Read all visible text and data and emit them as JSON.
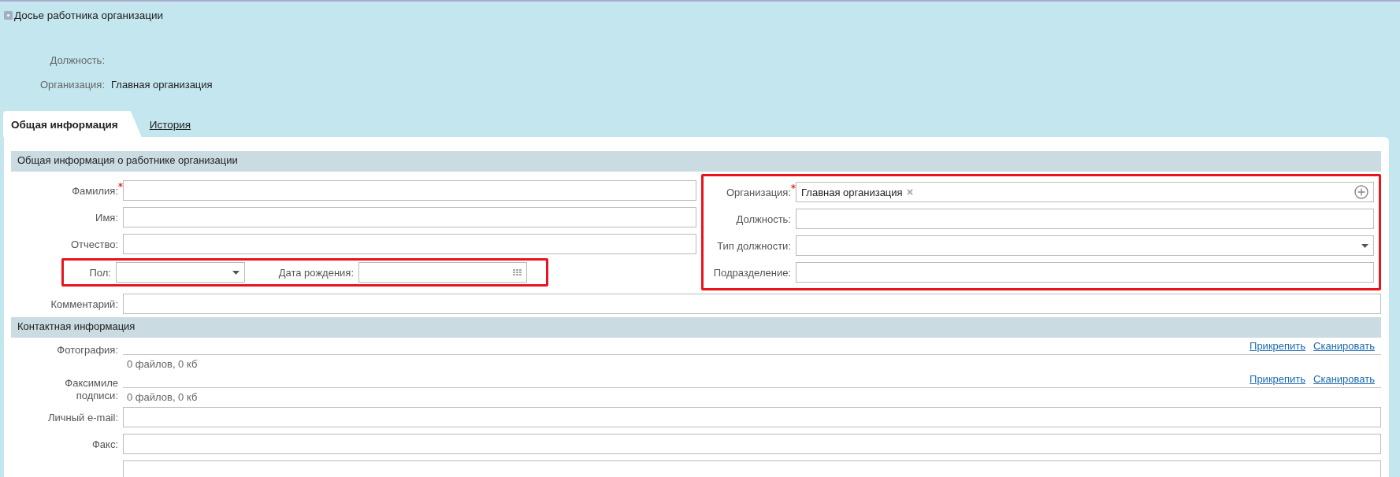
{
  "window": {
    "title": "Досье работника организации"
  },
  "header": [
    {
      "label": "Должность:"
    },
    {
      "label": "Организация:",
      "value": "Главная организация"
    }
  ],
  "tabs": [
    {
      "label": "Общая информация",
      "selected": true
    },
    {
      "label": "История",
      "selected": false
    }
  ],
  "general": {
    "title": "Общая информация о работнике организации",
    "fields_left": [
      {
        "label": "Фамилия:",
        "kind": "text",
        "required": true
      },
      {
        "label": "Имя:",
        "kind": "text",
        "required": false
      },
      {
        "label": "Отчество:",
        "kind": "text",
        "required": false
      }
    ],
    "pair_row": {
      "highlighted": true,
      "fields": [
        {
          "label": "Пол:",
          "kind": "select",
          "required": false
        },
        {
          "label": "Дата рождения:",
          "kind": "date",
          "required": false
        }
      ]
    },
    "fields_right": {
      "highlighted": true,
      "fields": [
        {
          "label": "Организация:",
          "kind": "tags",
          "required": true,
          "tags": [
            "Главная организация"
          ]
        },
        {
          "label": "Должность:",
          "kind": "text",
          "required": false
        },
        {
          "label": "Тип должности:",
          "kind": "select",
          "required": false
        },
        {
          "label": "Подразделение:",
          "kind": "text",
          "required": false
        }
      ]
    },
    "comment": {
      "label": "Комментарий:",
      "kind": "text",
      "required": false
    }
  },
  "contacts": {
    "title": "Контактная информация",
    "attachments": [
      {
        "label": "Фотография:",
        "summary": "0 файлов, 0 кб",
        "actions": [
          "Прикрепить",
          "Сканировать"
        ]
      },
      {
        "label": "Факсимиле подписи:",
        "summary": "0 файлов, 0 кб",
        "actions": [
          "Прикрепить",
          "Сканировать"
        ]
      }
    ],
    "fields": [
      {
        "label": "Личный e-mail:",
        "kind": "text",
        "required": false
      },
      {
        "label": "Факс:",
        "kind": "text",
        "required": false
      },
      {
        "kind": "text"
      }
    ]
  }
}
